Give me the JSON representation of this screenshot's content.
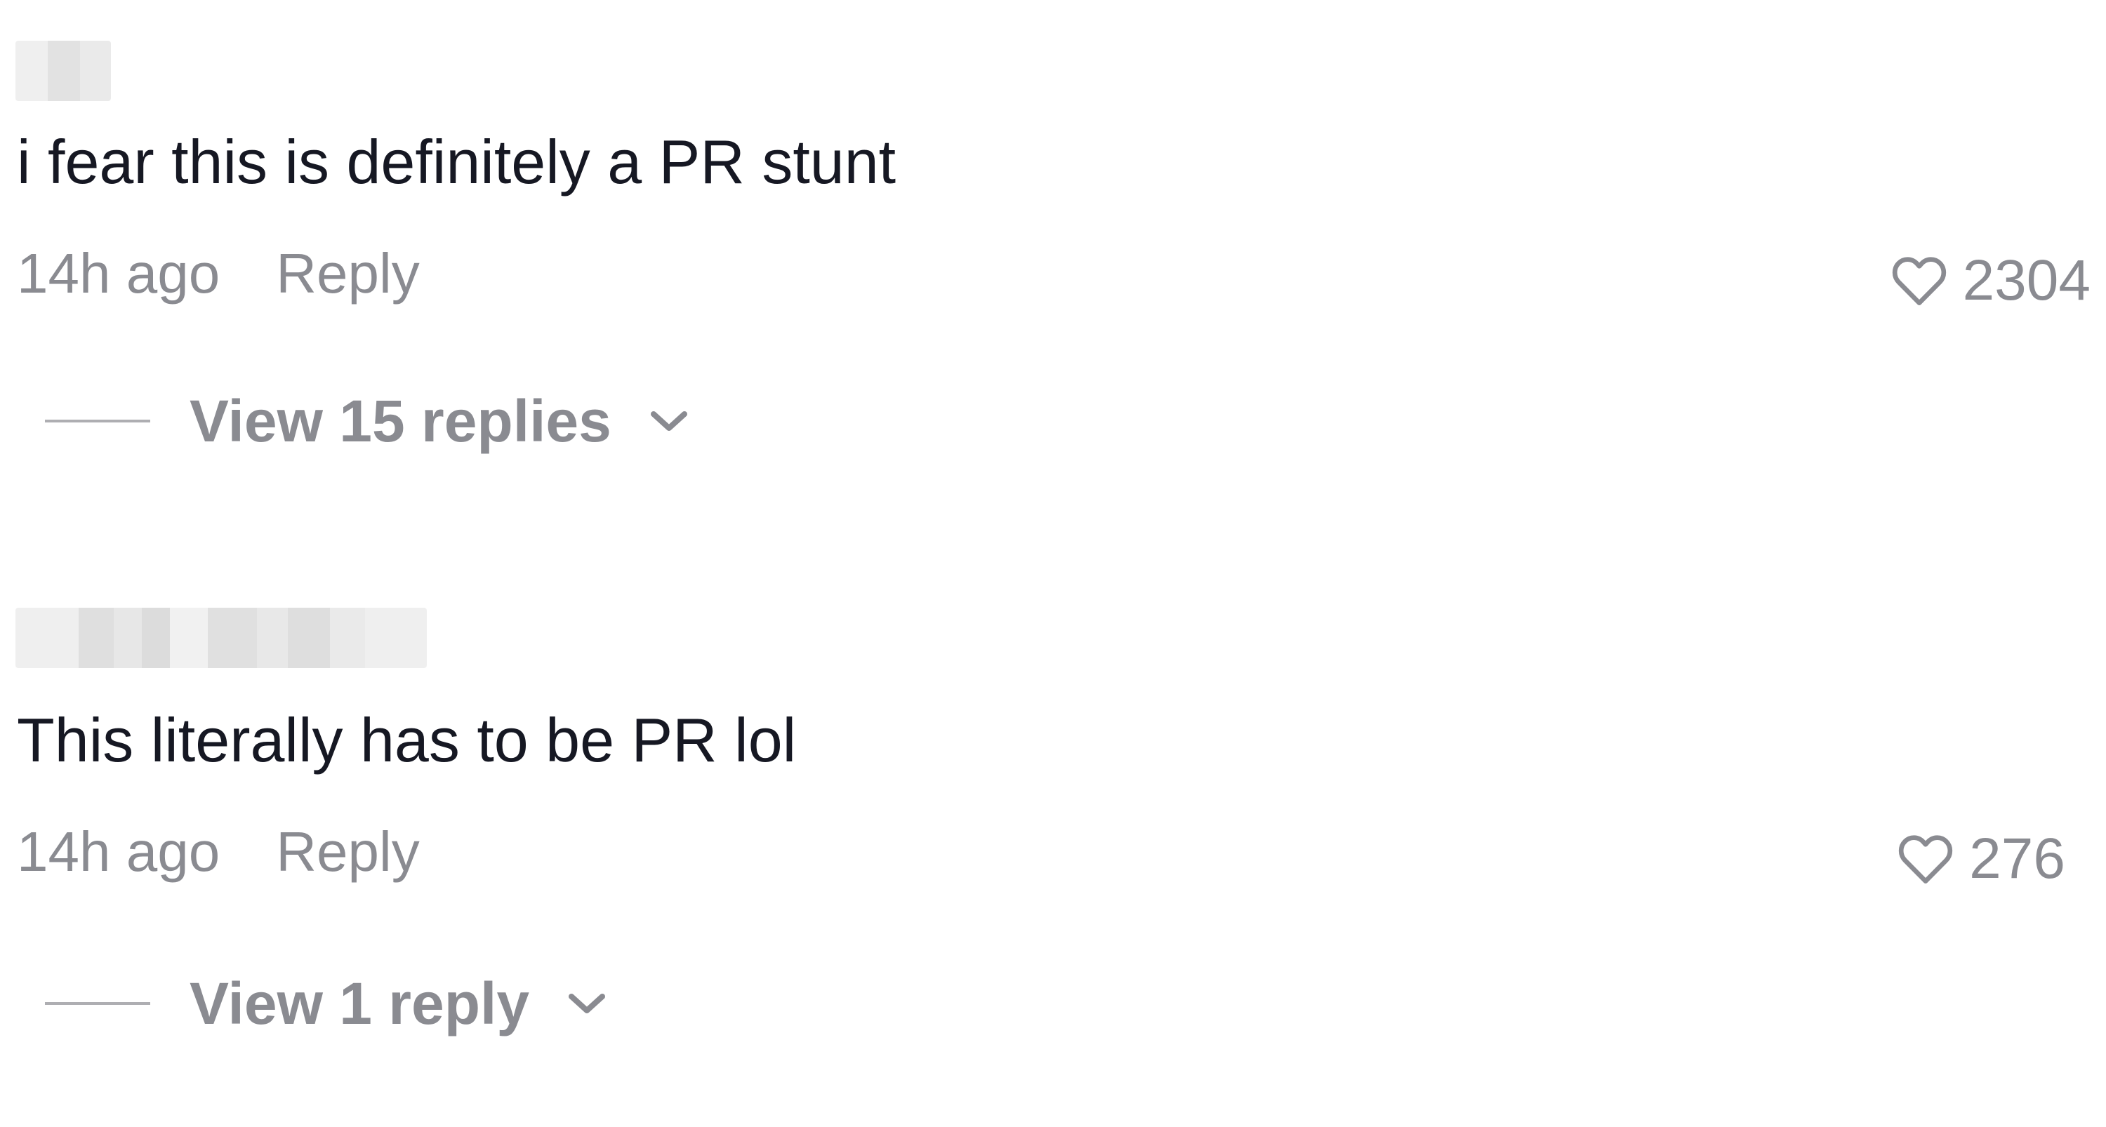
{
  "colors": {
    "text_primary": "#161823",
    "text_secondary": "#8a8b91",
    "blur_light": "#e4e4e4",
    "blur_dark": "#cdcdcd"
  },
  "comments": [
    {
      "text": "i fear this is definitely a PR stunt",
      "time": "14h ago",
      "reply_label": "Reply",
      "likes": "2304",
      "view_replies": "View 15 replies",
      "icons": {
        "like": "heart-outline-icon",
        "expand": "chevron-down-icon"
      }
    },
    {
      "text": "This literally has to be PR lol",
      "time": "14h ago",
      "reply_label": "Reply",
      "likes": "276",
      "view_replies": "View 1 reply",
      "icons": {
        "like": "heart-outline-icon",
        "expand": "chevron-down-icon"
      }
    }
  ]
}
